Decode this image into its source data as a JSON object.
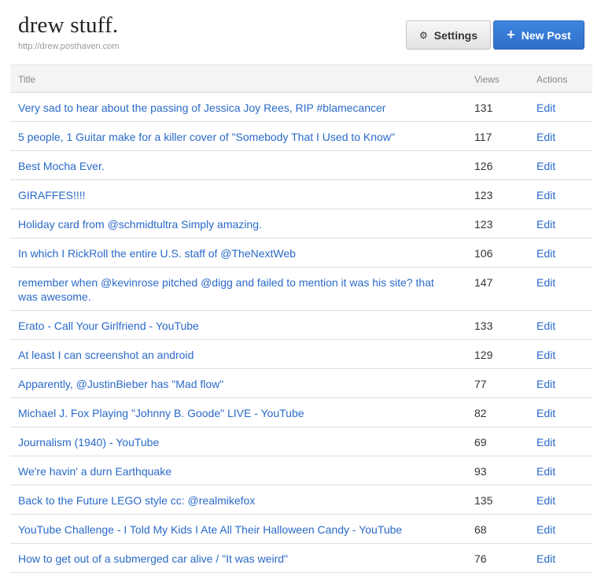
{
  "site": {
    "title": "drew stuff.",
    "url": "http://drew.posthaven.com"
  },
  "toolbar": {
    "settings_label": "Settings",
    "settings_icon": "gear-icon",
    "new_post_label": "New Post",
    "new_post_icon": "plus-icon",
    "new_post_color": "#3479d6"
  },
  "table": {
    "headers": {
      "title": "Title",
      "views": "Views",
      "actions": "Actions"
    },
    "rows": [
      {
        "title": "Very sad to hear about the passing of Jessica Joy Rees, RIP #blamecancer",
        "views": "131",
        "action": "Edit"
      },
      {
        "title": "5 people, 1 Guitar make for a killer cover of \"Somebody That I Used to Know\"",
        "views": "117",
        "action": "Edit"
      },
      {
        "title": "Best Mocha Ever.",
        "views": "126",
        "action": "Edit"
      },
      {
        "title": "GIRAFFES!!!!",
        "views": "123",
        "action": "Edit"
      },
      {
        "title": "Holiday card from @schmidtultra Simply amazing.",
        "views": "123",
        "action": "Edit"
      },
      {
        "title": "In which I RickRoll the entire U.S. staff of @TheNextWeb",
        "views": "106",
        "action": "Edit"
      },
      {
        "title": "remember when @kevinrose pitched @digg and failed to mention it was his site? that was awesome.",
        "views": "147",
        "action": "Edit"
      },
      {
        "title": "Erato - Call Your Girlfriend - YouTube",
        "views": "133",
        "action": "Edit"
      },
      {
        "title": "At least I can screenshot an android",
        "views": "129",
        "action": "Edit"
      },
      {
        "title": "Apparently, @JustinBieber has \"Mad flow\"",
        "views": "77",
        "action": "Edit"
      },
      {
        "title": "Michael J. Fox Playing \"Johnny B. Goode\" LIVE - YouTube",
        "views": "82",
        "action": "Edit"
      },
      {
        "title": "Journalism (1940) - YouTube",
        "views": "69",
        "action": "Edit"
      },
      {
        "title": "We're havin' a durn Earthquake",
        "views": "93",
        "action": "Edit"
      },
      {
        "title": "Back to the Future LEGO style cc: @realmikefox",
        "views": "135",
        "action": "Edit"
      },
      {
        "title": "YouTube Challenge - I Told My Kids I Ate All Their Halloween Candy - YouTube",
        "views": "68",
        "action": "Edit"
      },
      {
        "title": "How to get out of a submerged car alive / \"It was weird\"",
        "views": "76",
        "action": "Edit"
      }
    ]
  }
}
